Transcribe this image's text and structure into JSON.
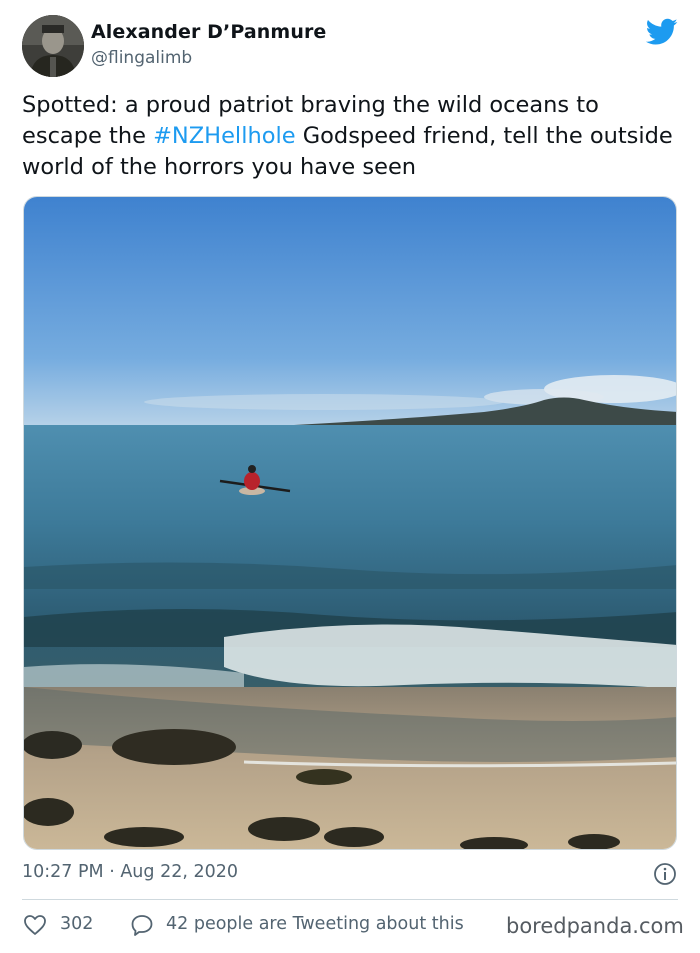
{
  "tweet": {
    "author_name": "Alexander D’Panmure",
    "author_handle": "@flingalimb",
    "text_before": "Spotted: a proud patriot braving the wild oceans to escape the ",
    "hashtag": "#NZHellhole",
    "text_after": " Godspeed friend, tell the outside world of the horrors you have seen",
    "timestamp": "10:27 PM · Aug 22, 2020",
    "likes": "302",
    "talking_about": "42 people are Tweeting about this"
  },
  "icons": {
    "brand": "twitter-bird-icon",
    "info": "info-icon",
    "like": "heart-icon",
    "reply": "speech-bubble-icon"
  },
  "watermark": "boredpanda.com",
  "colors": {
    "accent": "#1d9bf0",
    "text": "#0f1419",
    "secondary_text": "#536471",
    "divider": "#cfd9de"
  }
}
